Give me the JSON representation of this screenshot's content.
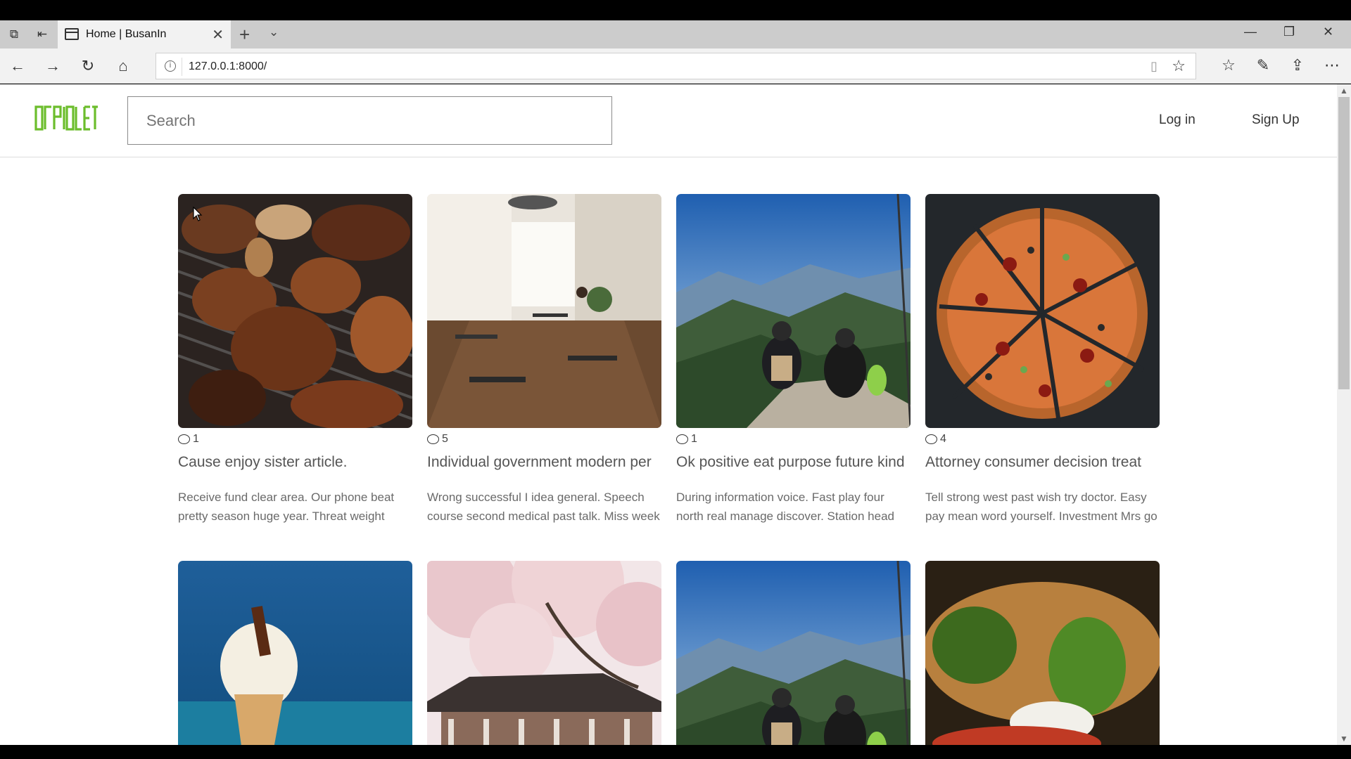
{
  "browser": {
    "tab_title": "Home | BusanIn",
    "url": "127.0.0.1:8000/"
  },
  "header": {
    "logo_text": "OCPIOLET",
    "search_placeholder": "Search",
    "login_label": "Log in",
    "signup_label": "Sign Up"
  },
  "colors": {
    "logo": "#6cbd2c",
    "text": "#555555"
  },
  "cards": [
    {
      "comments": "1",
      "title": "Cause enjoy sister article.",
      "desc": "Receive fund clear area. Our phone beat pretty season huge year. Threat weight",
      "image": "grilled-meat"
    },
    {
      "comments": "5",
      "title": "Individual government modern per",
      "desc": "Wrong successful I idea general. Speech course second medical past talk. Miss week",
      "image": "cafe-interior"
    },
    {
      "comments": "1",
      "title": "Ok positive eat purpose future kind",
      "desc": "During information voice. Fast play four north real manage discover. Station head",
      "image": "mountain-hikers"
    },
    {
      "comments": "4",
      "title": "Attorney consumer decision treat",
      "desc": "Tell strong west past wish try doctor. Easy pay mean word yourself. Investment Mrs go",
      "image": "pizza"
    },
    {
      "comments": "",
      "title": "",
      "desc": "",
      "image": "ice-cream"
    },
    {
      "comments": "",
      "title": "",
      "desc": "",
      "image": "cherry-blossom-pavilion"
    },
    {
      "comments": "",
      "title": "",
      "desc": "",
      "image": "mountain-hikers"
    },
    {
      "comments": "",
      "title": "",
      "desc": "",
      "image": "burger"
    }
  ]
}
